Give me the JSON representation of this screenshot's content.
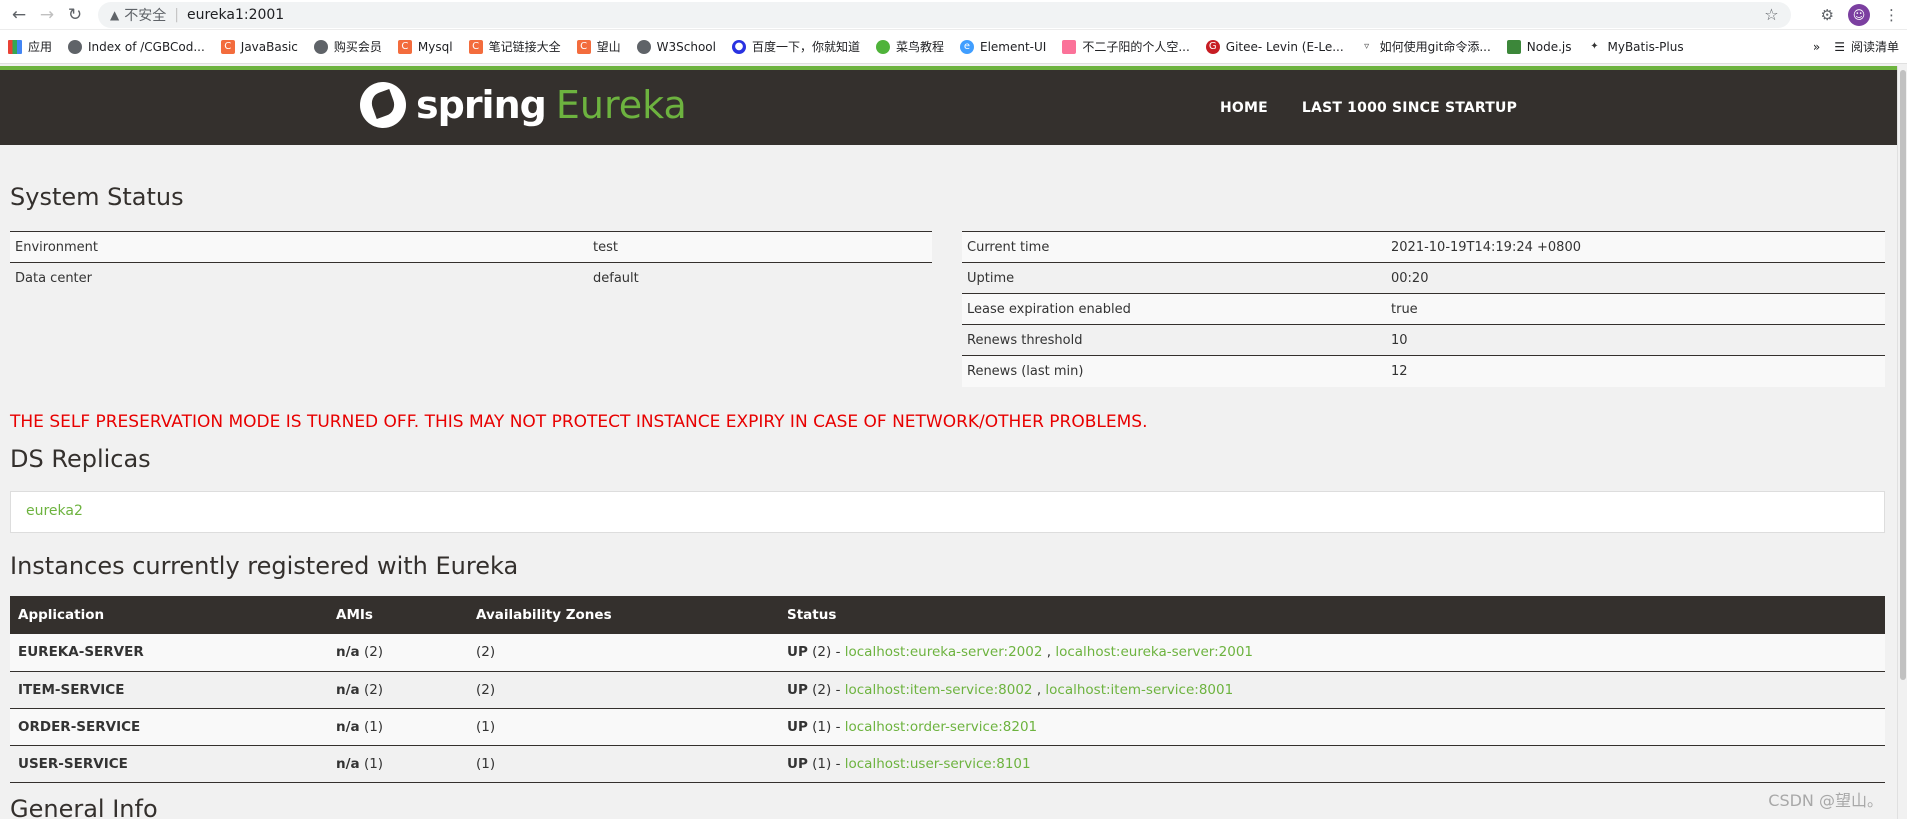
{
  "browser": {
    "insecure_label": "不安全",
    "url": "eureka1:2001",
    "bookmarks": [
      {
        "label": "应用",
        "icon": "apps-grid-icon"
      },
      {
        "label": "Index of /CGBCod...",
        "icon": "globe-icon"
      },
      {
        "label": "JavaBasic",
        "icon": "csdn-c-icon"
      },
      {
        "label": "购买会员",
        "icon": "globe-icon"
      },
      {
        "label": "Mysql",
        "icon": "csdn-c-icon"
      },
      {
        "label": "笔记链接大全",
        "icon": "csdn-c-icon"
      },
      {
        "label": "望山",
        "icon": "csdn-c-icon"
      },
      {
        "label": "W3School",
        "icon": "globe-icon"
      },
      {
        "label": "百度一下，你就知道",
        "icon": "baidu-paw-icon"
      },
      {
        "label": "菜鸟教程",
        "icon": "runoob-icon"
      },
      {
        "label": "Element-UI",
        "icon": "element-icon"
      },
      {
        "label": "不二子阳的个人空...",
        "icon": "bilibili-icon"
      },
      {
        "label": "Gitee- Levin (E-Le...",
        "icon": "gitee-icon"
      },
      {
        "label": "如何使用git命令添...",
        "icon": "triangle-icon"
      },
      {
        "label": "Node.js",
        "icon": "nodejs-icon"
      },
      {
        "label": "MyBatis-Plus",
        "icon": "mybatis-bird-icon"
      }
    ],
    "more_label": "»",
    "reading_list_label": "阅读清单"
  },
  "header": {
    "logo_spring": "spring",
    "logo_eureka": "Eureka",
    "nav": [
      "HOME",
      "LAST 1000 SINCE STARTUP"
    ]
  },
  "system_status": {
    "title": "System Status",
    "left": [
      {
        "key": "Environment",
        "value": "test"
      },
      {
        "key": "Data center",
        "value": "default"
      }
    ],
    "right": [
      {
        "key": "Current time",
        "value": "2021-10-19T14:19:24 +0800"
      },
      {
        "key": "Uptime",
        "value": "00:20"
      },
      {
        "key": "Lease expiration enabled",
        "value": "true"
      },
      {
        "key": "Renews threshold",
        "value": "10"
      },
      {
        "key": "Renews (last min)",
        "value": "12"
      }
    ]
  },
  "warning": "THE SELF PRESERVATION MODE IS TURNED OFF. THIS MAY NOT PROTECT INSTANCE EXPIRY IN CASE OF NETWORK/OTHER PROBLEMS.",
  "ds_replicas": {
    "title": "DS Replicas",
    "items": [
      "eureka2"
    ]
  },
  "instances": {
    "title": "Instances currently registered with Eureka",
    "headers": [
      "Application",
      "AMIs",
      "Availability Zones",
      "Status"
    ],
    "rows": [
      {
        "app": "EUREKA-SERVER",
        "ami_bold": "n/a",
        "ami_count": "(2)",
        "az": "(2)",
        "status_bold": "UP",
        "status_count": "(2) - ",
        "links": [
          "localhost:eureka-server:2002",
          "localhost:eureka-server:2001"
        ]
      },
      {
        "app": "ITEM-SERVICE",
        "ami_bold": "n/a",
        "ami_count": "(2)",
        "az": "(2)",
        "status_bold": "UP",
        "status_count": "(2) - ",
        "links": [
          "localhost:item-service:8002",
          "localhost:item-service:8001"
        ]
      },
      {
        "app": "ORDER-SERVICE",
        "ami_bold": "n/a",
        "ami_count": "(1)",
        "az": "(1)",
        "status_bold": "UP",
        "status_count": "(1) - ",
        "links": [
          "localhost:order-service:8201"
        ]
      },
      {
        "app": "USER-SERVICE",
        "ami_bold": "n/a",
        "ami_count": "(1)",
        "az": "(1)",
        "status_bold": "UP",
        "status_count": "(1) - ",
        "links": [
          "localhost:user-service:8101"
        ]
      }
    ]
  },
  "general_info": {
    "title": "General Info"
  },
  "watermark": "CSDN @望山。",
  "colors": {
    "header_bg": "#34302d",
    "accent_green": "#6db33f",
    "warning_red": "#e80000"
  }
}
